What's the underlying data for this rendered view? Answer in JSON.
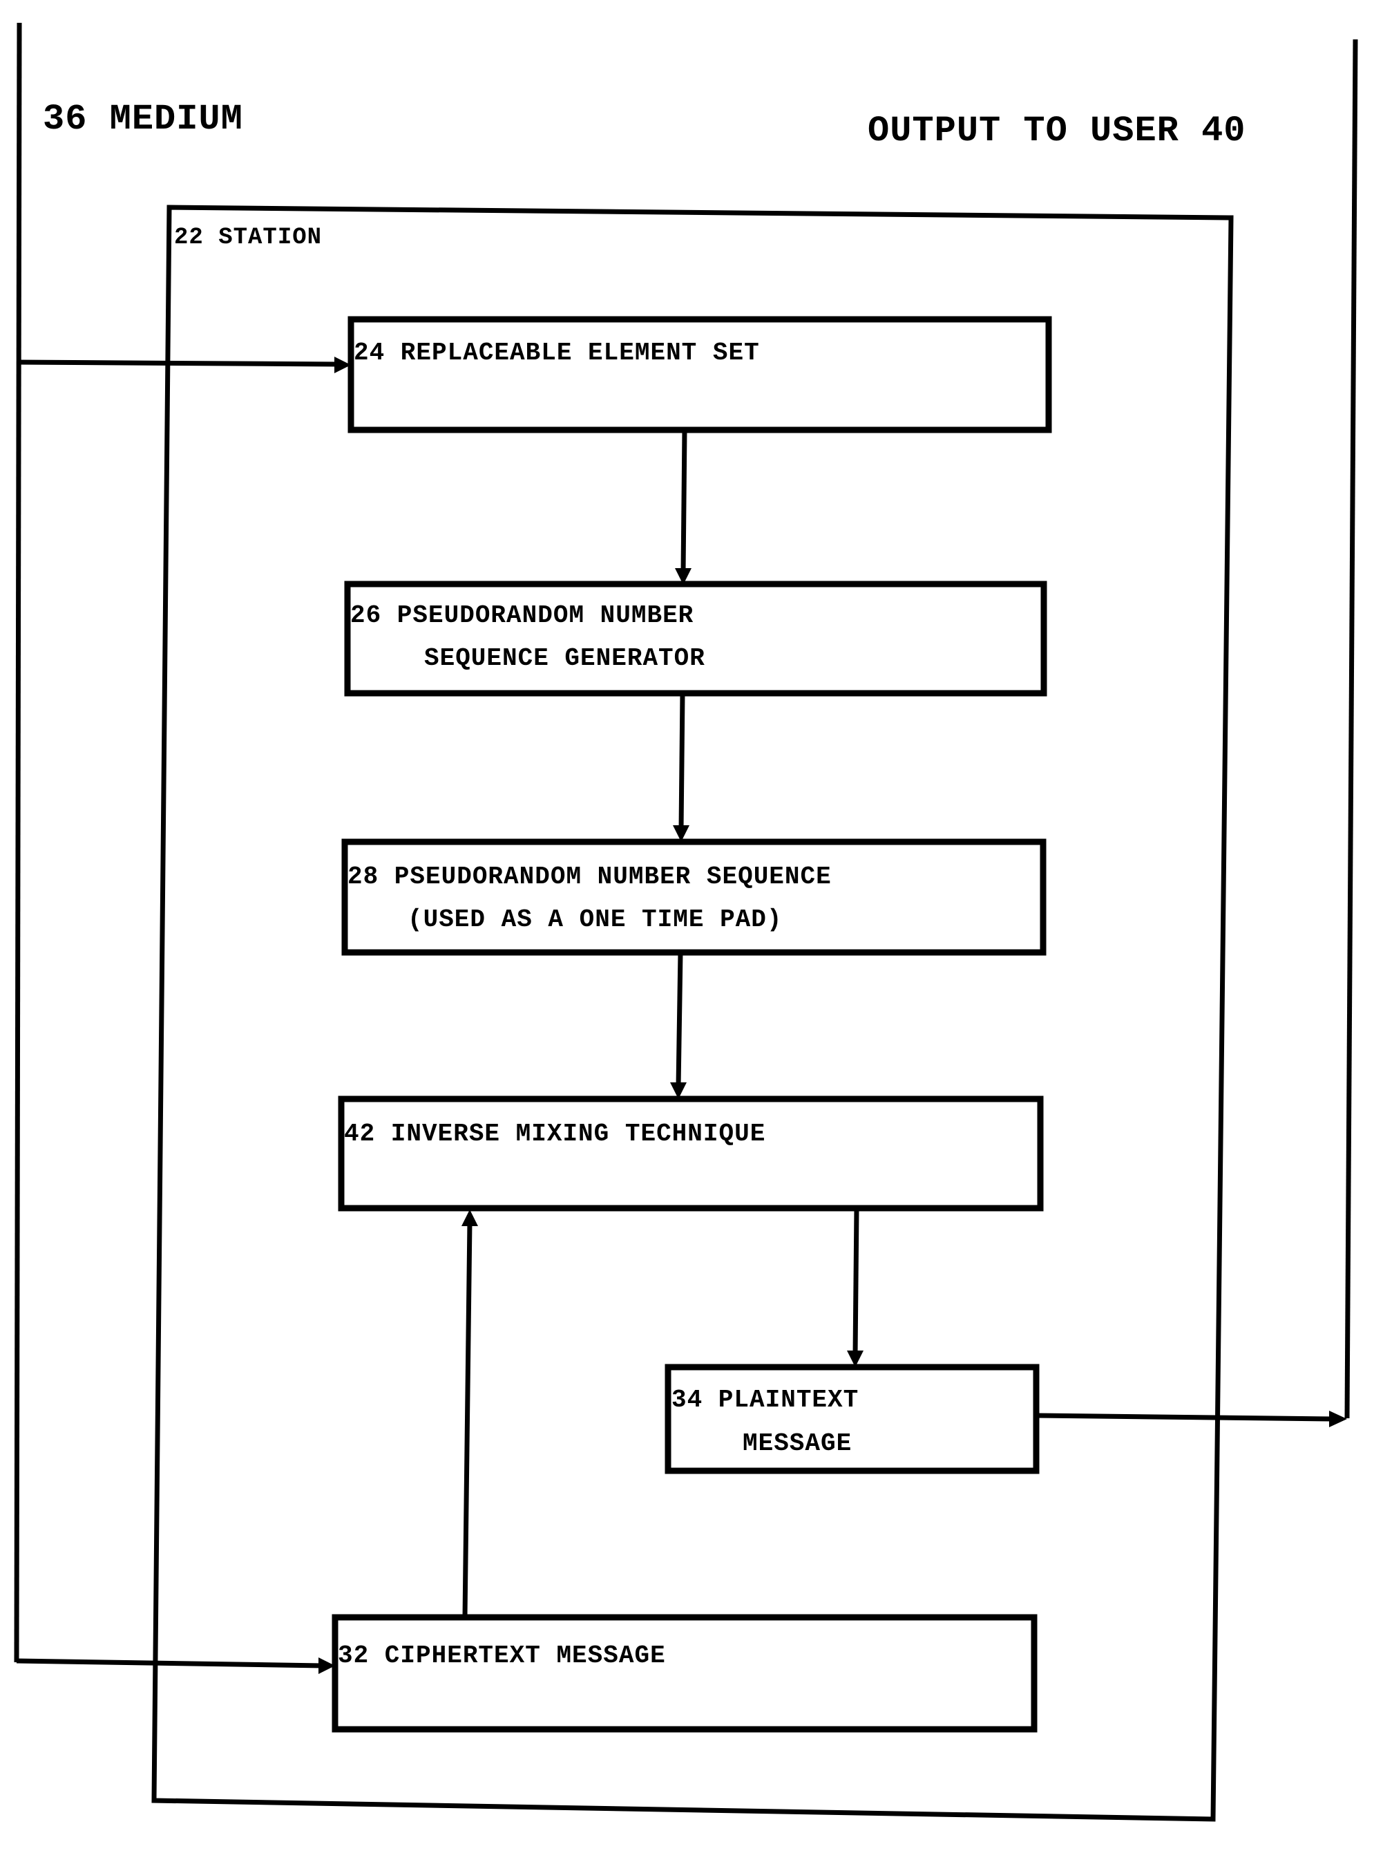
{
  "diagram": {
    "medium_label": "36 MEDIUM",
    "output_label": "OUTPUT TO USER 40",
    "station_label": "22 STATION",
    "boxes": [
      {
        "id": "24",
        "line1": "24 REPLACEABLE ELEMENT SET",
        "line2": ""
      },
      {
        "id": "26",
        "line1": "26 PSEUDORANDOM NUMBER",
        "line2": "SEQUENCE GENERATOR"
      },
      {
        "id": "28",
        "line1": "28 PSEUDORANDOM NUMBER SEQUENCE",
        "line2": "(USED AS A ONE TIME PAD)"
      },
      {
        "id": "42",
        "line1": "42 INVERSE MIXING TECHNIQUE",
        "line2": ""
      },
      {
        "id": "34",
        "line1": "34 PLAINTEXT",
        "line2": "MESSAGE"
      },
      {
        "id": "32",
        "line1": "32 CIPHERTEXT MESSAGE",
        "line2": ""
      }
    ],
    "connections": [
      {
        "from": "36",
        "to": "24"
      },
      {
        "from": "24",
        "to": "26"
      },
      {
        "from": "26",
        "to": "28"
      },
      {
        "from": "28",
        "to": "42"
      },
      {
        "from": "32",
        "to": "42"
      },
      {
        "from": "42",
        "to": "34"
      },
      {
        "from": "34",
        "to": "40"
      },
      {
        "from": "36",
        "to": "32"
      }
    ]
  }
}
